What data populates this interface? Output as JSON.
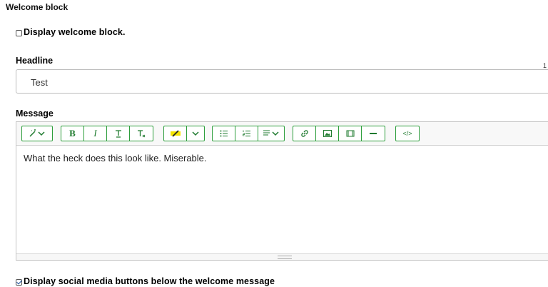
{
  "section_title": "Welcome block",
  "display_welcome": {
    "label": "Display welcome block.",
    "checked": false
  },
  "headline": {
    "label": "Headline",
    "value": "Test",
    "counter": "1"
  },
  "message": {
    "label": "Message",
    "body": "What the heck does this look like.  Miserable.",
    "toolbar": {
      "magic": "magic-wand-icon",
      "bold": "B",
      "italic": "I",
      "underline": "T",
      "clear_format": "Tₓ",
      "highlight": "highlighter-icon",
      "bullets": "bulleted-list-icon",
      "numbers": "numbered-list-icon",
      "align": "align-icon",
      "link": "link-icon",
      "image": "image-icon",
      "media": "media-icon",
      "hr": "horizontal-rule-icon",
      "code": "</>"
    }
  },
  "social": {
    "label": "Display social media buttons below the welcome message",
    "checked": true
  },
  "colors": {
    "accent": "#2d9e3c",
    "highlight": "#f5e400",
    "check": "#1a4f9c"
  }
}
